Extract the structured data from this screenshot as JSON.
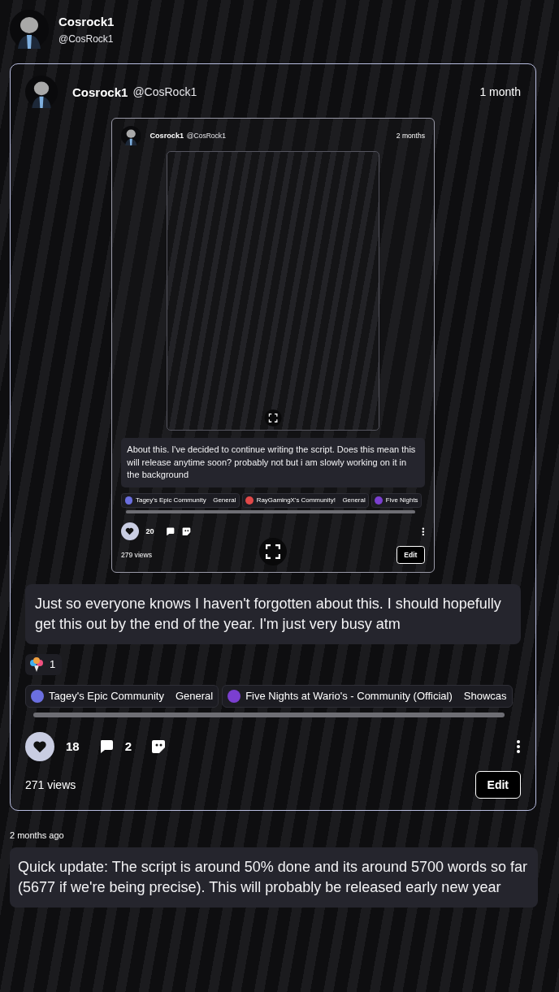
{
  "profile": {
    "name": "Cosrock1",
    "handle": "@CosRock1"
  },
  "post": {
    "author": "Cosrock1",
    "handle": "@CosRock1",
    "time": "1 month",
    "embed": {
      "author": "Cosrock1",
      "handle": "@CosRock1",
      "time": "2 months",
      "screenshot": true,
      "text": "About this. I've decided to continue writing the script. Does this mean this will release anytime soon? probably not but i am slowly working on it in the background",
      "communities": [
        {
          "name": "Tagey's Epic Community",
          "channel": "General",
          "color": "#6b6fe0"
        },
        {
          "name": "RayGamingX's Community!",
          "channel": "General",
          "color": "#e04848"
        },
        {
          "name": "Five Nights",
          "color": "#7b3fd0"
        }
      ],
      "liked": true,
      "likes": "20",
      "views": "279 views",
      "edit_label": "Edit"
    },
    "text": "Just so everyone knows I haven't forgotten about this. I should hopefully get this out by the end of the year. I'm just very busy atm",
    "reactions": [
      {
        "count": "1"
      }
    ],
    "communities": [
      {
        "name": "Tagey's Epic Community",
        "channel": "General",
        "color": "#6b6fe0"
      },
      {
        "name": "Five Nights at Wario's - Community (Official)",
        "channel": "Showcas",
        "color": "#7b3fd0"
      }
    ],
    "liked": true,
    "likes": "18",
    "comments": "2",
    "views": "271 views",
    "edit_label": "Edit"
  },
  "update": {
    "time": "2 months ago",
    "text": "Quick update: The script is around 50% done and its around 5700 words so far (5677 if we're being precise). This will probably be released early new year"
  }
}
